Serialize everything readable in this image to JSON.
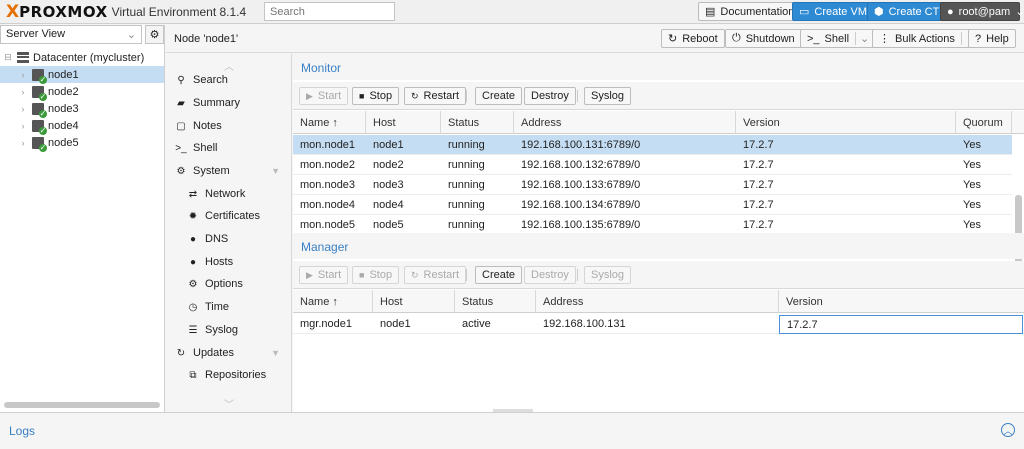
{
  "app": {
    "logo_mark": "X",
    "logo_name": "PROXMOX",
    "logo_subtitle": "Virtual Environment 8.1.4",
    "search_placeholder": "Search"
  },
  "topbar": {
    "documentation": "Documentation",
    "create_vm": "Create VM",
    "create_ct": "Create CT",
    "user": "root@pam"
  },
  "tree": {
    "view": "Server View",
    "datacenter": "Datacenter (mycluster)",
    "nodes": [
      "node1",
      "node2",
      "node3",
      "node4",
      "node5"
    ],
    "selected": "node1"
  },
  "header": {
    "title": "Node 'node1'",
    "reboot": "Reboot",
    "shutdown": "Shutdown",
    "shell": "Shell",
    "bulk_actions": "Bulk Actions",
    "help": "Help"
  },
  "menu": {
    "search": "Search",
    "summary": "Summary",
    "notes": "Notes",
    "shell": "Shell",
    "system": "System",
    "network": "Network",
    "certificates": "Certificates",
    "dns": "DNS",
    "hosts": "Hosts",
    "options": "Options",
    "time": "Time",
    "syslog": "Syslog",
    "updates": "Updates",
    "repositories": "Repositories"
  },
  "monitor": {
    "title": "Monitor",
    "buttons": {
      "start": "Start",
      "stop": "Stop",
      "restart": "Restart",
      "create": "Create",
      "destroy": "Destroy",
      "syslog": "Syslog"
    },
    "columns": {
      "name": "Name ↑",
      "host": "Host",
      "status": "Status",
      "address": "Address",
      "version": "Version",
      "quorum": "Quorum"
    },
    "rows": [
      {
        "name": "mon.node1",
        "host": "node1",
        "status": "running",
        "address": "192.168.100.131:6789/0",
        "version": "17.2.7",
        "quorum": "Yes"
      },
      {
        "name": "mon.node2",
        "host": "node2",
        "status": "running",
        "address": "192.168.100.132:6789/0",
        "version": "17.2.7",
        "quorum": "Yes"
      },
      {
        "name": "mon.node3",
        "host": "node3",
        "status": "running",
        "address": "192.168.100.133:6789/0",
        "version": "17.2.7",
        "quorum": "Yes"
      },
      {
        "name": "mon.node4",
        "host": "node4",
        "status": "running",
        "address": "192.168.100.134:6789/0",
        "version": "17.2.7",
        "quorum": "Yes"
      },
      {
        "name": "mon.node5",
        "host": "node5",
        "status": "running",
        "address": "192.168.100.135:6789/0",
        "version": "17.2.7",
        "quorum": "Yes"
      }
    ]
  },
  "manager": {
    "title": "Manager",
    "buttons": {
      "start": "Start",
      "stop": "Stop",
      "restart": "Restart",
      "create": "Create",
      "destroy": "Destroy",
      "syslog": "Syslog"
    },
    "columns": {
      "name": "Name ↑",
      "host": "Host",
      "status": "Status",
      "address": "Address",
      "version": "Version"
    },
    "rows": [
      {
        "name": "mgr.node1",
        "host": "node1",
        "status": "active",
        "address": "192.168.100.131",
        "version": "17.2.7"
      }
    ]
  },
  "logs": {
    "title": "Logs"
  },
  "colors": {
    "accent": "#3a80c4",
    "brand": "#e57000",
    "selection": "#c4ddf3",
    "button_blue": "#2e8ad3"
  }
}
